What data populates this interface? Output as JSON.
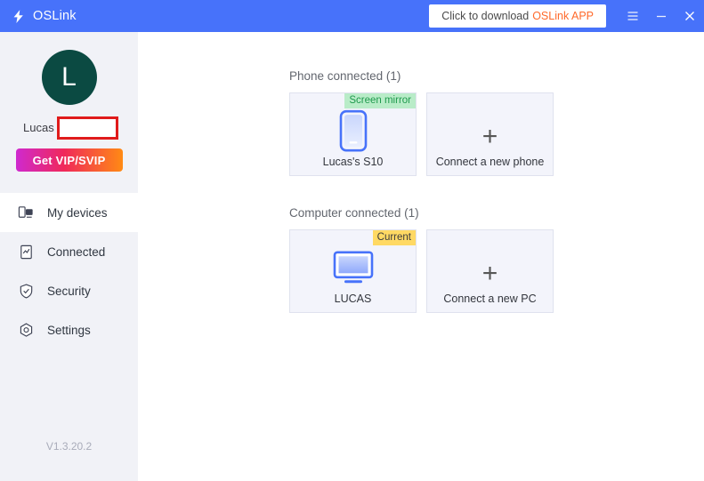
{
  "titlebar": {
    "brand": "OSLink",
    "logo_icon": "lightning-bolt-icon",
    "download_text": "Click to download ",
    "download_accent": "OSLink APP",
    "menu_icon": "hamburger-menu-icon",
    "minimize_icon": "minimize-icon",
    "close_icon": "close-icon",
    "bg_color": "#4772fa"
  },
  "sidebar": {
    "avatar_initial": "L",
    "avatar_color": "#0b4a42",
    "username": "Lucas",
    "redaction_border_color": "#e01b1b",
    "vip_button": "Get VIP/SVIP",
    "version": "V1.3.20.2",
    "items": [
      {
        "label": "My devices",
        "icon": "devices-icon",
        "active": true
      },
      {
        "label": "Connected",
        "icon": "connected-report-icon",
        "active": false
      },
      {
        "label": "Security",
        "icon": "shield-check-icon",
        "active": false
      },
      {
        "label": "Settings",
        "icon": "gear-hexagon-icon",
        "active": false
      }
    ]
  },
  "main": {
    "sections": [
      {
        "title": "Phone connected (1)",
        "cards": [
          {
            "label": "Lucas's S10",
            "badge": "Screen mirror",
            "badge_type": "mirror",
            "badge_bg": "#b9ecc8",
            "badge_color": "#1f9a4d",
            "icon": "phone-icon"
          },
          {
            "label": "Connect a new phone",
            "badge": "",
            "icon": "plus-icon"
          }
        ]
      },
      {
        "title": "Computer connected (1)",
        "cards": [
          {
            "label": "LUCAS",
            "badge": "Current",
            "badge_type": "current",
            "badge_bg": "#ffd964",
            "badge_color": "#3c3c3c",
            "icon": "monitor-icon"
          },
          {
            "label": "Connect a new PC",
            "badge": "",
            "icon": "plus-icon"
          }
        ]
      }
    ],
    "plus_glyph": "+"
  }
}
